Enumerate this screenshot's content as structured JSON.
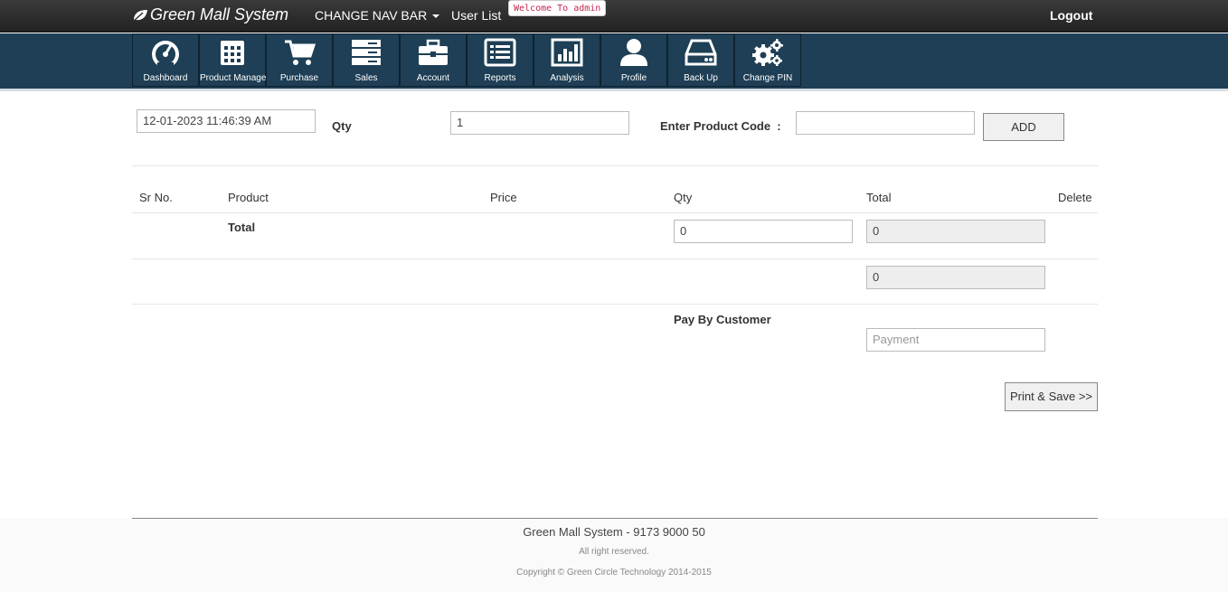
{
  "navbar": {
    "brand": "Green Mall System",
    "change_nav": "CHANGE NAV BAR",
    "user_list": "User List",
    "welcome": "Welcome To admin",
    "logout": "Logout"
  },
  "iconbar": {
    "tiles": [
      {
        "label": "Dashboard",
        "icon": "dashboard-gauge-icon"
      },
      {
        "label": "Product Manage",
        "icon": "calendar-grid-icon"
      },
      {
        "label": "Purchase",
        "icon": "cart-icon"
      },
      {
        "label": "Sales",
        "icon": "server-stack-icon"
      },
      {
        "label": "Account",
        "icon": "briefcase-icon"
      },
      {
        "label": "Reports",
        "icon": "list-alt-icon"
      },
      {
        "label": "Analysis",
        "icon": "bar-chart-icon"
      },
      {
        "label": "Profile",
        "icon": "user-icon"
      },
      {
        "label": "Back Up",
        "icon": "hard-drive-icon"
      },
      {
        "label": "Change PIN",
        "icon": "cogs-icon"
      }
    ]
  },
  "form": {
    "datetime_value": "12-01-2023 11:46:39 AM",
    "qty_label": "Qty",
    "qty_value": "1",
    "product_code_label": "Enter Product Code  :",
    "product_code_value": "",
    "add_label": "ADD"
  },
  "table": {
    "headers": [
      "Sr No.",
      "Product",
      "Price",
      "Qty",
      "Total",
      "Delete"
    ],
    "total_label": "Total",
    "total_qty": "0",
    "total_amount": "0",
    "grand_total": "0",
    "pay_label": "Pay By Customer",
    "payment_placeholder": "Payment"
  },
  "actions": {
    "print_save": "Print & Save >>"
  },
  "footer": {
    "title": "Green Mall System - 9173 9000 50",
    "rights": "All right reserved.",
    "copyright": "Copyright © Green Circle Technology 2014-2015"
  },
  "colors": {
    "iconbar_bg": "#1e3f55",
    "topbar_bg": "#2b2b2b",
    "welcome_text": "#c7254e"
  }
}
